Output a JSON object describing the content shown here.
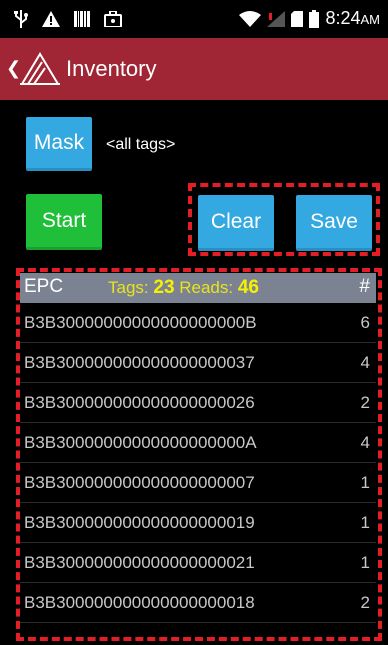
{
  "status_bar": {
    "icons_left": [
      "usb-icon",
      "warning-icon",
      "barcode-icon",
      "briefcase-icon"
    ],
    "icons_right": [
      "wifi-icon",
      "signal-icon",
      "sim-icon",
      "battery-icon"
    ],
    "time": "8:24",
    "ampm": "AM"
  },
  "action_bar": {
    "title": "Inventory"
  },
  "controls": {
    "mask_label": "Mask",
    "mask_value": "<all tags>",
    "start_label": "Start",
    "clear_label": "Clear",
    "save_label": "Save"
  },
  "table": {
    "epc_header": "EPC",
    "tags_label": "Tags:",
    "tags_count": "23",
    "reads_label": "Reads:",
    "reads_count": "46",
    "count_header": "#",
    "rows": [
      {
        "epc": "B3B30000000000000000000B",
        "count": "6"
      },
      {
        "epc": "B3B300000000000000000037",
        "count": "4"
      },
      {
        "epc": "B3B300000000000000000026",
        "count": "2"
      },
      {
        "epc": "B3B30000000000000000000A",
        "count": "4"
      },
      {
        "epc": "B3B300000000000000000007",
        "count": "1"
      },
      {
        "epc": "B3B300000000000000000019",
        "count": "1"
      },
      {
        "epc": "B3B300000000000000000021",
        "count": "1"
      },
      {
        "epc": "B3B300000000000000000018",
        "count": "2"
      }
    ]
  },
  "colors": {
    "action_bar": "#a02535",
    "button_blue": "#34a8e0",
    "button_green": "#1fbf3a",
    "highlight": "#e31e24",
    "table_header": "#7b8393",
    "stats_yellow": "#f7f000"
  }
}
